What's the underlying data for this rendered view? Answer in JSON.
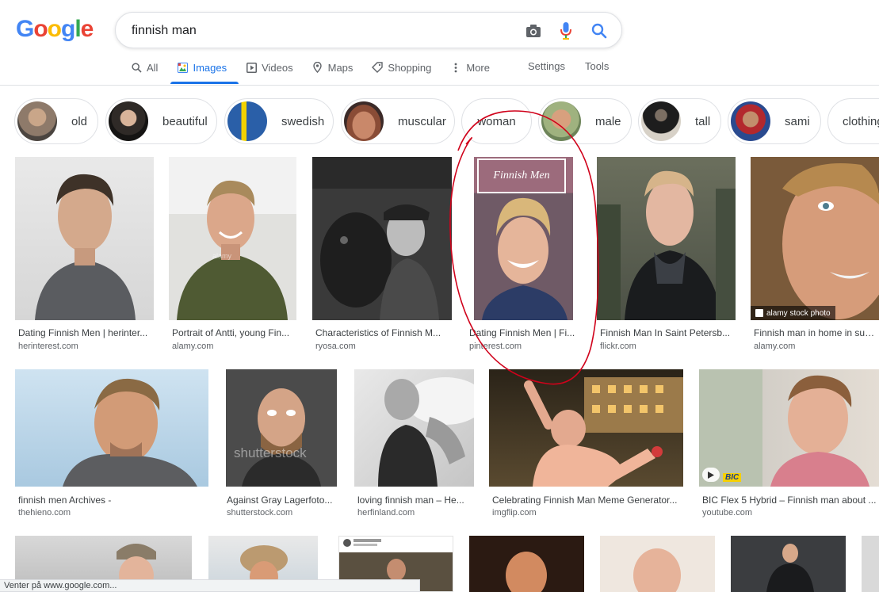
{
  "logo": {
    "letters": [
      {
        "ch": "G",
        "color": "#4285F4"
      },
      {
        "ch": "o",
        "color": "#EA4335"
      },
      {
        "ch": "o",
        "color": "#FBBC05"
      },
      {
        "ch": "g",
        "color": "#4285F4"
      },
      {
        "ch": "l",
        "color": "#34A853"
      },
      {
        "ch": "e",
        "color": "#EA4335"
      }
    ]
  },
  "search": {
    "query": "finnish man",
    "icons": [
      "camera-icon",
      "microphone-icon",
      "search-icon"
    ]
  },
  "tabs": [
    {
      "label": "All",
      "icon": "search-icon",
      "active": false
    },
    {
      "label": "Images",
      "icon": "image-icon",
      "active": true
    },
    {
      "label": "Videos",
      "icon": "video-icon",
      "active": false
    },
    {
      "label": "Maps",
      "icon": "pin-icon",
      "active": false
    },
    {
      "label": "Shopping",
      "icon": "tag-icon",
      "active": false
    },
    {
      "label": "More",
      "icon": "kebab-icon",
      "active": false
    }
  ],
  "tools": {
    "settings": "Settings",
    "tools": "Tools"
  },
  "chips": [
    {
      "label": "old"
    },
    {
      "label": "beautiful"
    },
    {
      "label": "swedish"
    },
    {
      "label": "muscular"
    },
    {
      "label": "woman"
    },
    {
      "label": "male"
    },
    {
      "label": "tall"
    },
    {
      "label": "sami"
    },
    {
      "label": "clothing"
    }
  ],
  "results": {
    "row1": [
      {
        "title": "Dating Finnish Men | herinter...",
        "site": "herinterest.com"
      },
      {
        "title": "Portrait of Antti, young Fin...",
        "site": "alamy.com",
        "watermark": "alamy"
      },
      {
        "title": "Characteristics of Finnish M...",
        "site": "ryosa.com"
      },
      {
        "title": "Dating Finnish Men | Fi...",
        "site": "pinterest.com",
        "overlay_text": "Finnish Men"
      },
      {
        "title": "Finnish Man In Saint Petersb...",
        "site": "flickr.com"
      },
      {
        "title": "Finnish man in home in summ",
        "site": "alamy.com",
        "badge": "alamy stock photo"
      }
    ],
    "row2": [
      {
        "title": "finnish men Archives -",
        "site": "thehieno.com"
      },
      {
        "title": "Against Gray Lagerfoto...",
        "site": "shutterstock.com",
        "watermark": "shutterstock"
      },
      {
        "title": "loving finnish man – He...",
        "site": "herfinland.com"
      },
      {
        "title": "Celebrating Finnish Man Meme Generator...",
        "site": "imgflip.com"
      },
      {
        "title": "BIC Flex 5 Hybrid – Finnish man about ...",
        "site": "youtube.com",
        "brand": "BIC"
      }
    ]
  },
  "status_bar": "Venter på www.google.com...",
  "annotation": {
    "color": "#d0021b"
  }
}
